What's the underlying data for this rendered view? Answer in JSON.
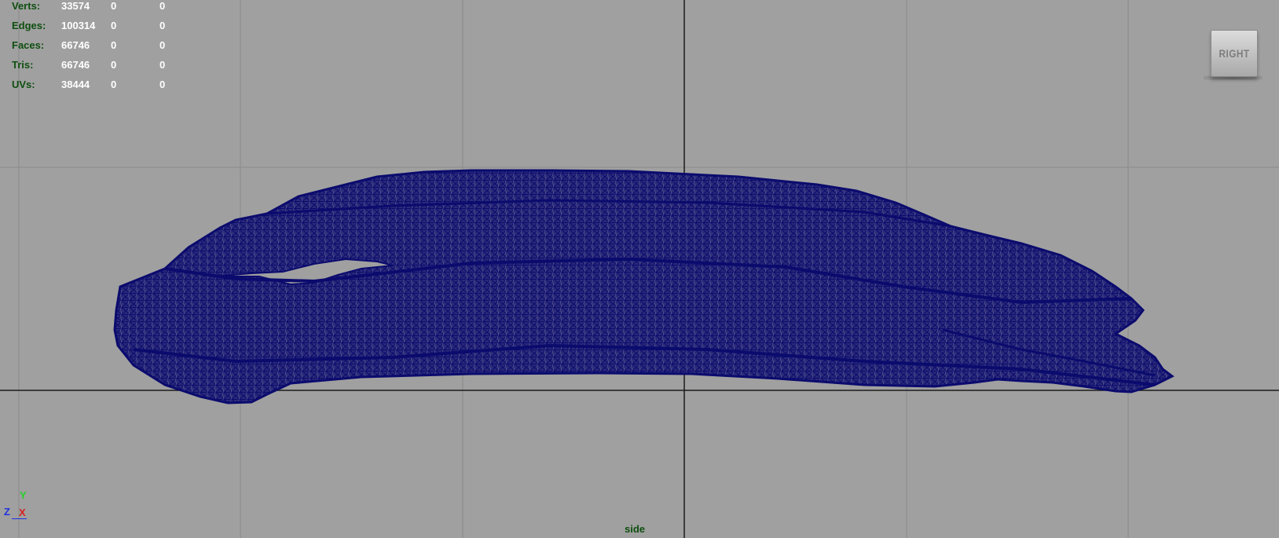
{
  "stats": {
    "rows": [
      {
        "label": "Verts:",
        "values": [
          "33574",
          "0",
          "0"
        ]
      },
      {
        "label": "Edges:",
        "values": [
          "100314",
          "0",
          "0"
        ]
      },
      {
        "label": "Faces:",
        "values": [
          "66746",
          "0",
          "0"
        ]
      },
      {
        "label": "Tris:",
        "values": [
          "66746",
          "0",
          "0"
        ]
      },
      {
        "label": "UVs:",
        "values": [
          "38444",
          "0",
          "0"
        ]
      }
    ]
  },
  "view_cube": {
    "label": "RIGHT"
  },
  "axis_gizmo": {
    "y": "Y",
    "z": "Z",
    "x": "X"
  },
  "camera": {
    "name": "side"
  },
  "viewport": {
    "grid": true
  },
  "colors": {
    "background": "#a0a0a0",
    "grid_line": "#8a8a8a",
    "grid_axis": "#1a1a1a",
    "wireframe": "#0b0b6e",
    "mesh_fill": "#2a2a7a",
    "hud_label": "#0f4f10",
    "hud_value": "#ffffff",
    "axis_x": "#d62020",
    "axis_y": "#28d028",
    "axis_z": "#2030e0"
  }
}
